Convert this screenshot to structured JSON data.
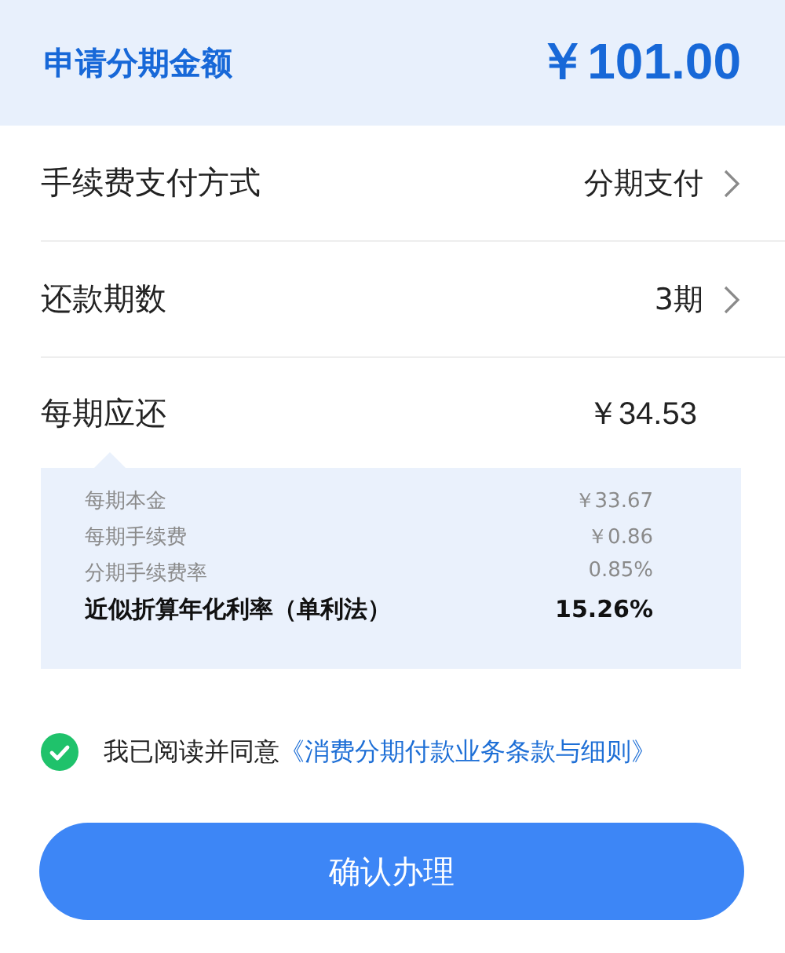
{
  "header": {
    "title": "申请分期金额",
    "amount": "￥101.00"
  },
  "options": [
    {
      "label": "手续费支付方式",
      "value": "分期支付"
    },
    {
      "label": "还款期数",
      "value": "3期"
    }
  ],
  "per_period": {
    "label": "每期应还",
    "amount": "￥34.53"
  },
  "details": [
    {
      "label": "每期本金",
      "value": "￥33.67",
      "bold": false
    },
    {
      "label": "每期手续费",
      "value": "￥0.86",
      "bold": false
    },
    {
      "label": "分期手续费率",
      "value": "0.85%",
      "bold": false
    },
    {
      "label": "近似折算年化利率（单利法）",
      "value": "15.26%",
      "bold": true
    }
  ],
  "agreement": {
    "checked": true,
    "text": "我已阅读并同意",
    "link": "《消费分期付款业务条款与细则》"
  },
  "confirm_button": "确认办理"
}
